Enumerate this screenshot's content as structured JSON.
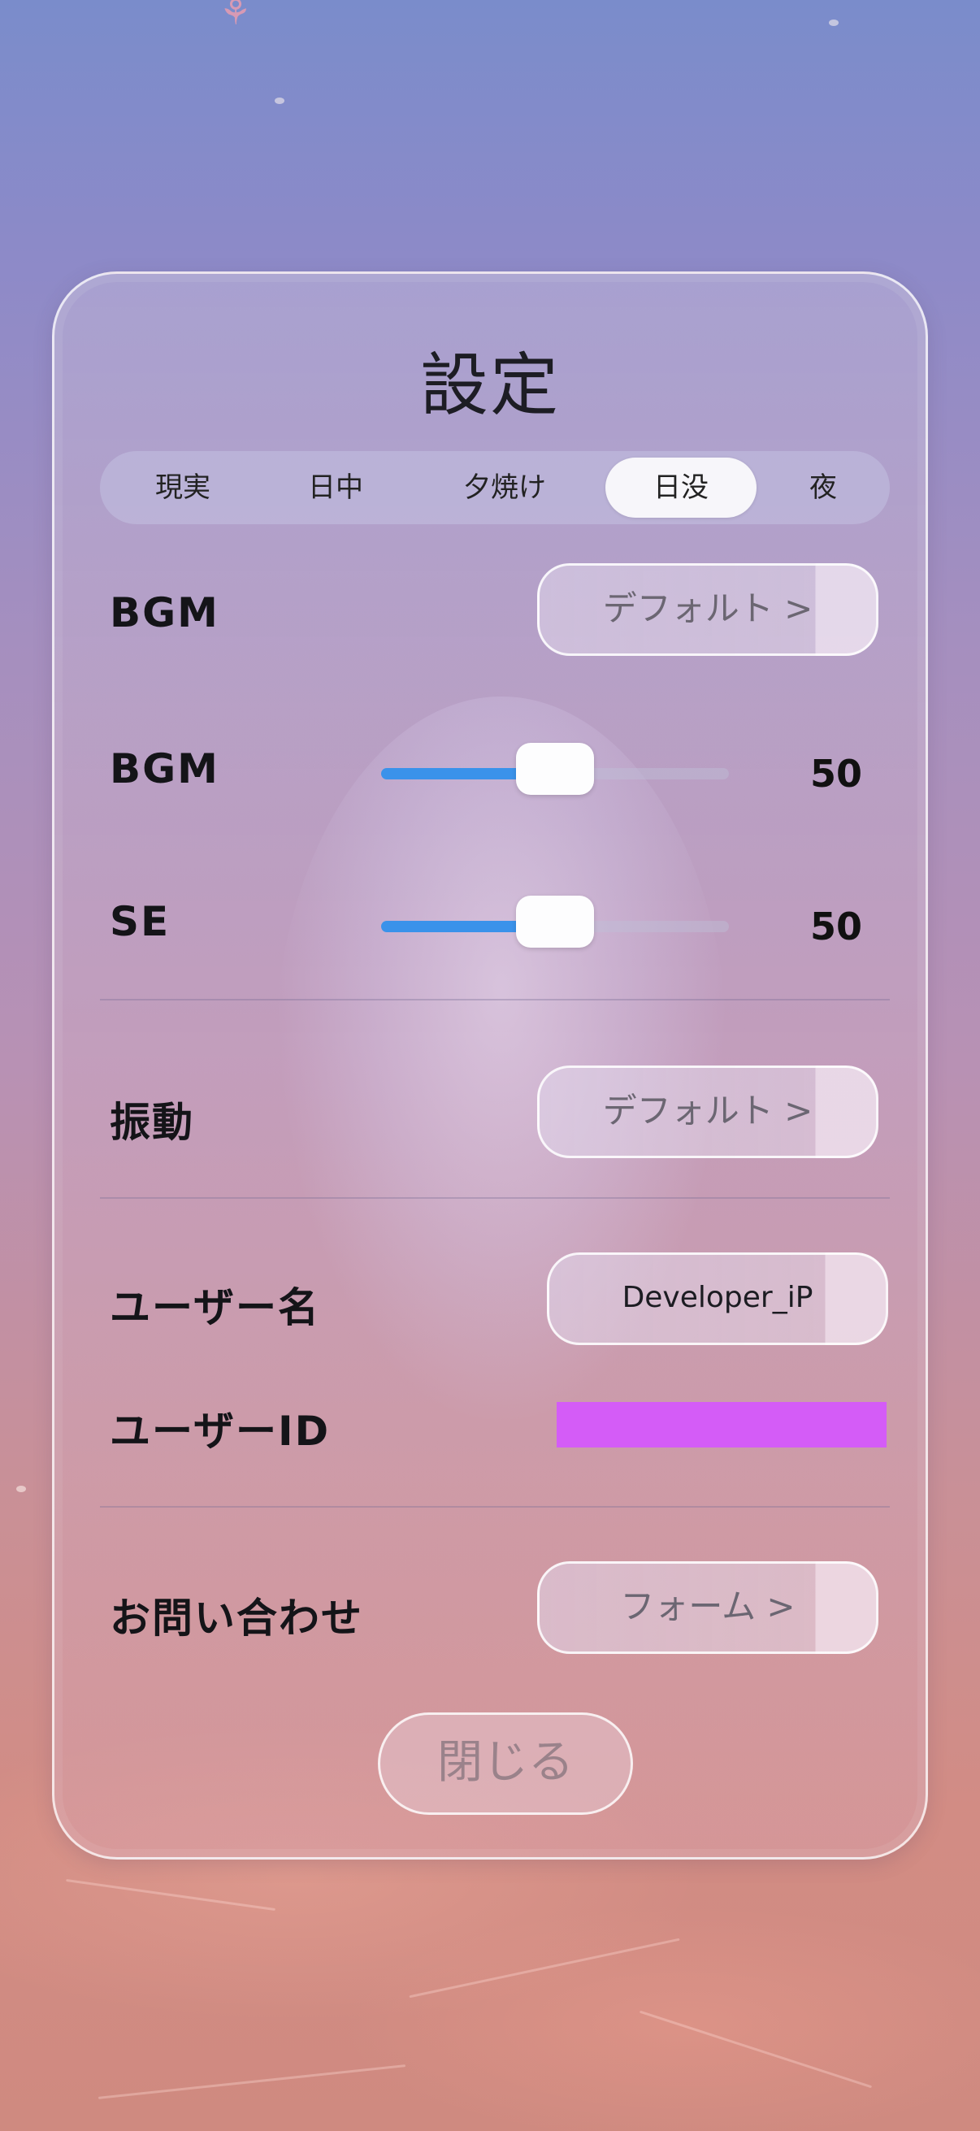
{
  "settings": {
    "title": "設定",
    "time_tabs": [
      {
        "label": "現実",
        "active": false
      },
      {
        "label": "日中",
        "active": false
      },
      {
        "label": "夕焼け",
        "active": false
      },
      {
        "label": "日没",
        "active": true
      },
      {
        "label": "夜",
        "active": false
      }
    ],
    "bgm_track": {
      "label": "BGM",
      "button": "デフォルト >"
    },
    "bgm_volume": {
      "label": "BGM",
      "value": "50",
      "level": 0.5
    },
    "se_volume": {
      "label": "SE",
      "value": "50",
      "level": 0.5
    },
    "vibration": {
      "label": "振動",
      "button": "デフォルト >"
    },
    "username": {
      "label": "ユーザー名",
      "value": "Developer_iP"
    },
    "user_id": {
      "label": "ユーザーID",
      "redaction_color": "#d45cf7"
    },
    "contact": {
      "label": "お問い合わせ",
      "button": "フォーム >"
    },
    "close_button": "閉じる"
  },
  "colors": {
    "accent": "#3a92ea",
    "redaction": "#d45cf7"
  }
}
